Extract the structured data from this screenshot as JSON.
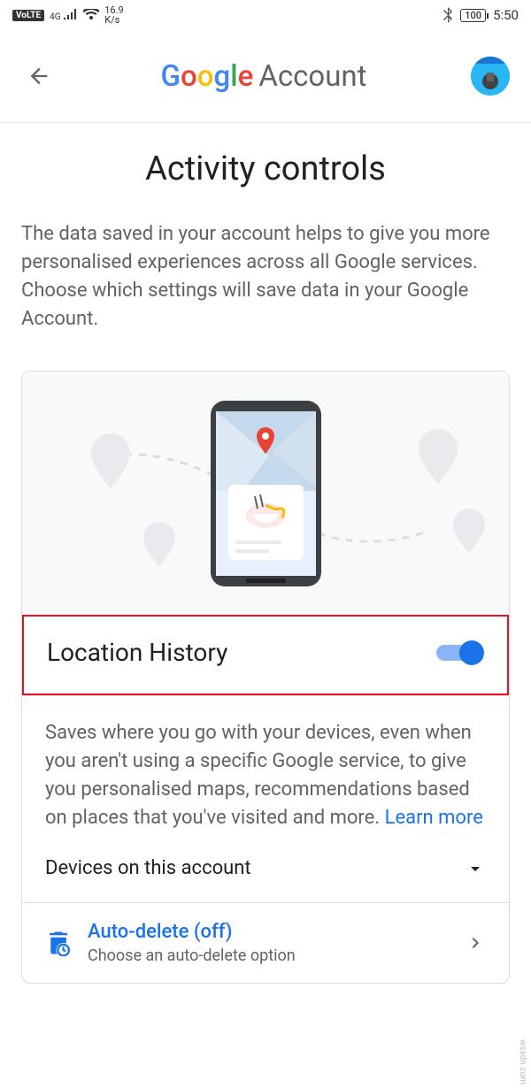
{
  "status_bar": {
    "volte": "VoLTE",
    "net_type": "4G",
    "speed_value": "16.9",
    "speed_unit": "K/s",
    "battery": "100",
    "time": "5:50"
  },
  "app_bar": {
    "logo_g1": "G",
    "logo_o1": "o",
    "logo_o2": "o",
    "logo_g2": "g",
    "logo_l": "l",
    "logo_e": "e",
    "account": "Account"
  },
  "page": {
    "title": "Activity controls",
    "description": "The data saved in your account helps to give you more personalised experiences across all Google services. Choose which settings will save data in your Google Account."
  },
  "location_history": {
    "title": "Location History",
    "toggle_on": true,
    "description": "Saves where you go with your devices, even when you aren't using a specific Google service, to give you personalised maps, recommendations based on places that you've visited and more. ",
    "learn_more": "Learn more",
    "devices_label": "Devices on this account"
  },
  "auto_delete": {
    "title": "Auto-delete (off)",
    "subtitle": "Choose an auto-delete option"
  },
  "watermark": "wsxdn.com"
}
